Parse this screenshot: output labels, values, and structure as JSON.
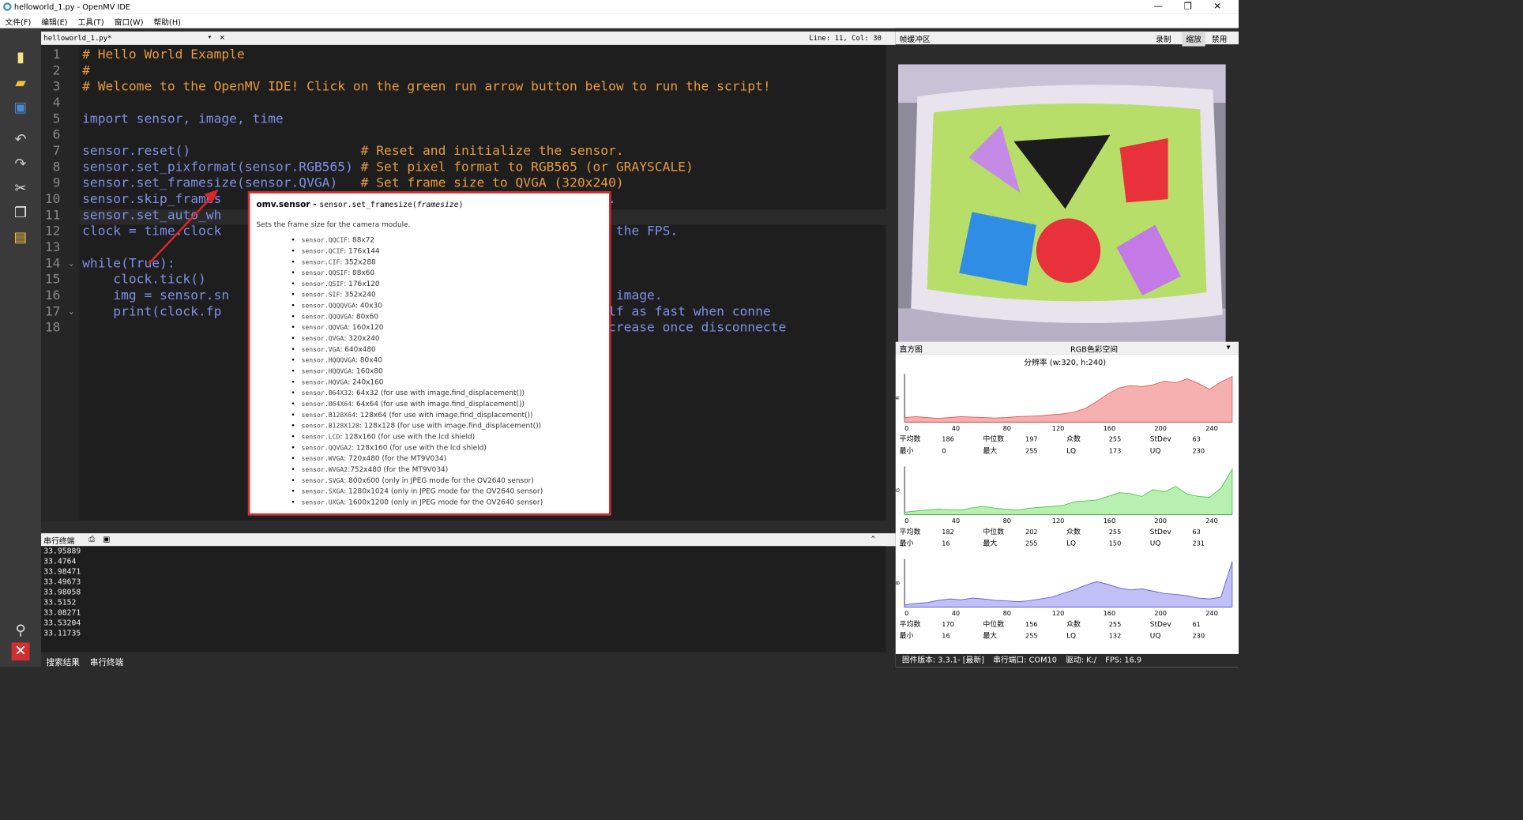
{
  "window": {
    "title": "helloworld_1.py - OpenMV IDE",
    "min": "—",
    "max": "❐",
    "close": "✕"
  },
  "menu": [
    "文件(F)",
    "编辑(E)",
    "工具(T)",
    "窗口(W)",
    "帮助(H)"
  ],
  "editor_tab": {
    "filename": "helloworld_1.py*",
    "cursor_pos": "Line: 11, Col: 30"
  },
  "code_lines": [
    "# Hello World Example",
    "#",
    "# Welcome to the OpenMV IDE! Click on the green run arrow button below to run the script!",
    "",
    "import sensor, image, time",
    "",
    "sensor.reset()                      # Reset and initialize the sensor.",
    "sensor.set_pixformat(sensor.RGB565) # Set pixel format to RGB565 (or GRAYSCALE)",
    "sensor.set_framesize(sensor.QVGA)   # Set frame size to QVGA (320x240)",
    "sensor.skip_frames                                          e effect.",
    "sensor.set_auto_wh",
    "clock = time.clock                                          to track the FPS.",
    "",
    "while(True):",
    "    clock.tick()",
    "    img = sensor.sn                                         turn the image.",
    "    print(clock.fp                                          about half as fast when conne",
    "                                                            hould increase once disconnecte"
  ],
  "popup": {
    "module": "omv.sensor - ",
    "signature": "sensor.set_framesize(",
    "arg": "framesize",
    "close_paren": ")",
    "description": "Sets the frame size for the camera module.",
    "items": [
      {
        "c": "sensor.QQCIF",
        "d": ": 88x72"
      },
      {
        "c": "sensor.QCIF",
        "d": ": 176x144"
      },
      {
        "c": "sensor.CIF",
        "d": ": 352x288"
      },
      {
        "c": "sensor.QQSIF",
        "d": ": 88x60"
      },
      {
        "c": "sensor.QSIF",
        "d": ": 176x120"
      },
      {
        "c": "sensor.SIF",
        "d": ": 352x240"
      },
      {
        "c": "sensor.QQQQVGA",
        "d": ": 40x30"
      },
      {
        "c": "sensor.QQQVGA",
        "d": ": 80x60"
      },
      {
        "c": "sensor.QQVGA",
        "d": ": 160x120"
      },
      {
        "c": "sensor.QVGA",
        "d": ": 320x240"
      },
      {
        "c": "sensor.VGA",
        "d": ": 640x480"
      },
      {
        "c": "sensor.HQQQVGA",
        "d": ": 80x40"
      },
      {
        "c": "sensor.HQQVGA",
        "d": ": 160x80"
      },
      {
        "c": "sensor.HQVGA",
        "d": ": 240x160"
      },
      {
        "c": "sensor.B64X32",
        "d": ": 64x32 (for use with image.find_displacement())"
      },
      {
        "c": "sensor.B64X64",
        "d": ": 64x64 (for use with image.find_displacement())"
      },
      {
        "c": "sensor.B128X64",
        "d": ": 128x64 (for use with image.find_displacement())"
      },
      {
        "c": "sensor.B128X128",
        "d": ": 128x128 (for use with image.find_displacement())"
      },
      {
        "c": "sensor.LCD",
        "d": ": 128x160 (for use with the lcd shield)"
      },
      {
        "c": "sensor.QQVGA2",
        "d": ": 128x160 (for use with the lcd shield)"
      },
      {
        "c": "sensor.WVGA",
        "d": ": 720x480 (for the MT9V034)"
      },
      {
        "c": "sensor.WVGA2",
        "d": ":752x480 (for the MT9V034)"
      },
      {
        "c": "sensor.SVGA",
        "d": ": 800x600 (only in JPEG mode for the OV2640 sensor)"
      },
      {
        "c": "sensor.SXGA",
        "d": ": 1280x1024 (only in JPEG mode for the OV2640 sensor)"
      },
      {
        "c": "sensor.UXGA",
        "d": ": 1600x1200 (only in JPEG mode for the OV2640 sensor)"
      }
    ]
  },
  "terminal": {
    "title": "串行终端",
    "lines": [
      "33.95889",
      "33.4764",
      "33.98471",
      "33.49673",
      "33.98058",
      "33.5152",
      "33.08271",
      "33.53204",
      "33.11735"
    ]
  },
  "bottom_tabs": [
    "搜索结果",
    "串行终端"
  ],
  "framebuffer": {
    "title": "帧缓冲区",
    "record": "录制",
    "zoom": "缩放",
    "disable": "禁用"
  },
  "histogram": {
    "title": "直方图",
    "colorspace": "RGB色彩空间",
    "resolution": "分辨率 (w:320, h:240)",
    "axis_ticks": [
      "0",
      "40",
      "80",
      "120",
      "160",
      "200",
      "240"
    ],
    "stat_labels": [
      "平均数",
      "中位数",
      "众数",
      "StDev",
      "最小",
      "最大",
      "LQ",
      "UQ"
    ],
    "channels": [
      {
        "name": "R",
        "color": "#f7b0b0",
        "stroke": "#e05050",
        "mean": "186",
        "median": "197",
        "mode": "255",
        "stdev": "63",
        "min": "0",
        "max": "255",
        "lq": "173",
        "uq": "230"
      },
      {
        "name": "G",
        "color": "#b7f0b0",
        "stroke": "#40c040",
        "mean": "182",
        "median": "202",
        "mode": "255",
        "stdev": "63",
        "min": "16",
        "max": "255",
        "lq": "150",
        "uq": "231"
      },
      {
        "name": "B",
        "color": "#c0c0f7",
        "stroke": "#5050e0",
        "mean": "170",
        "median": "156",
        "mode": "255",
        "stdev": "61",
        "min": "16",
        "max": "255",
        "lq": "132",
        "uq": "230"
      }
    ]
  },
  "status": {
    "firmware": "固件版本: 3.3.1- [最新]",
    "port": "串行端口: COM10",
    "drive": "驱动: K:/",
    "fps": "FPS: 16.9"
  }
}
